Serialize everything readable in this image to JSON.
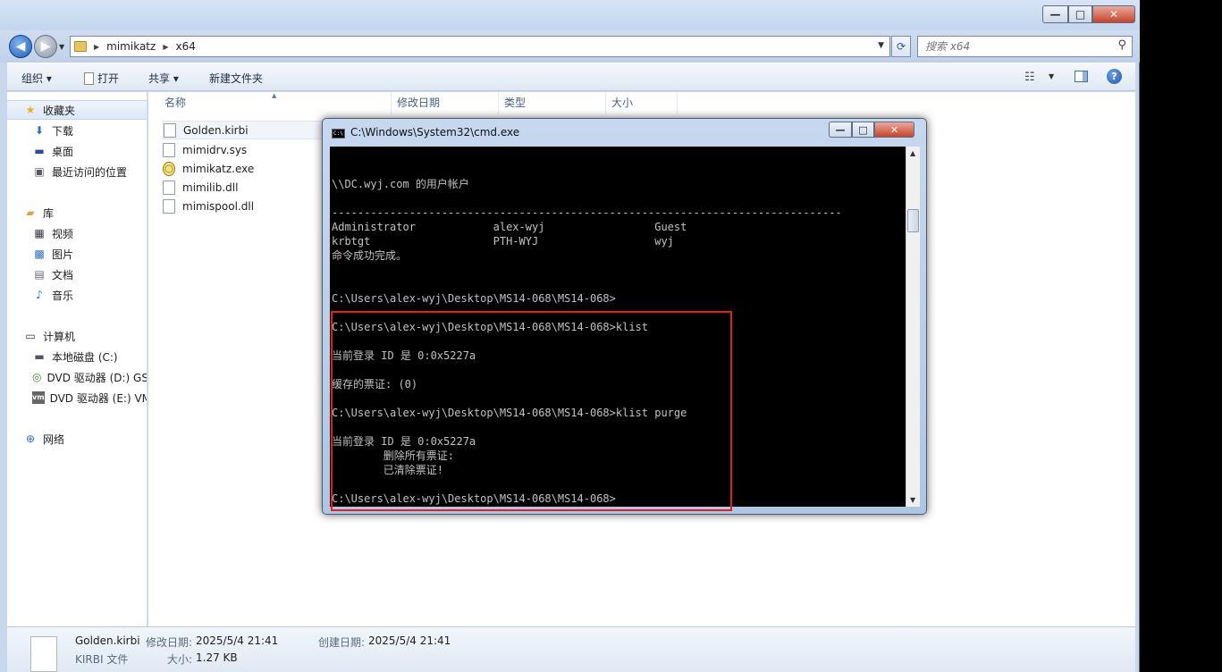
{
  "window": {
    "min": "—",
    "max": "□",
    "close": "✕"
  },
  "nav": {
    "breadcrumb": [
      "mimikatz",
      "x64"
    ],
    "search_placeholder": "搜索 x64"
  },
  "toolbar": {
    "organize": "组织 ▾",
    "open": "打开",
    "share": "共享 ▾",
    "new_folder": "新建文件夹"
  },
  "sidebar": {
    "favorites": "收藏夹",
    "downloads": "下载",
    "desktop": "桌面",
    "recent": "最近访问的位置",
    "libraries": "库",
    "videos": "视频",
    "pictures": "图片",
    "documents": "文档",
    "music": "音乐",
    "computer": "计算机",
    "drive_c": "本地磁盘 (C:)",
    "drive_d": "DVD 驱动器 (D:) GS",
    "drive_e": "DVD 驱动器 (E:) VM",
    "network": "网络"
  },
  "columns": {
    "name": "名称",
    "modified": "修改日期",
    "type": "类型",
    "size": "大小"
  },
  "files": [
    "Golden.kirbi",
    "mimidrv.sys",
    "mimikatz.exe",
    "mimilib.dll",
    "mimispool.dll"
  ],
  "details": {
    "filename": "Golden.kirbi",
    "filetype": "KIRBI 文件",
    "modified_label": "修改日期:",
    "modified_value": "2025/5/4 21:41",
    "created_label": "创建日期:",
    "created_value": "2025/5/4 21:41",
    "size_label": "大小:",
    "size_value": "1.27 KB"
  },
  "cmd": {
    "title": "C:\\Windows\\System32\\cmd.exe",
    "lines": [
      "\\\\DC.wyj.com 的用户帐户",
      "-------------------------------------------------------------------------------",
      "Administrator            alex-wyj                 Guest",
      "krbtgt                   PTH-WYJ                  wyj",
      "命令成功完成。",
      "C:\\Users\\alex-wyj\\Desktop\\MS14-068\\MS14-068>",
      "C:\\Users\\alex-wyj\\Desktop\\MS14-068\\MS14-068>klist",
      "当前登录 ID 是 0:0x5227a",
      "缓存的票证: (0)",
      "C:\\Users\\alex-wyj\\Desktop\\MS14-068\\MS14-068>klist purge",
      "当前登录 ID 是 0:0x5227a",
      "        删除所有票证:",
      "        已清除票证!",
      "C:\\Users\\alex-wyj\\Desktop\\MS14-068\\MS14-068>"
    ]
  }
}
